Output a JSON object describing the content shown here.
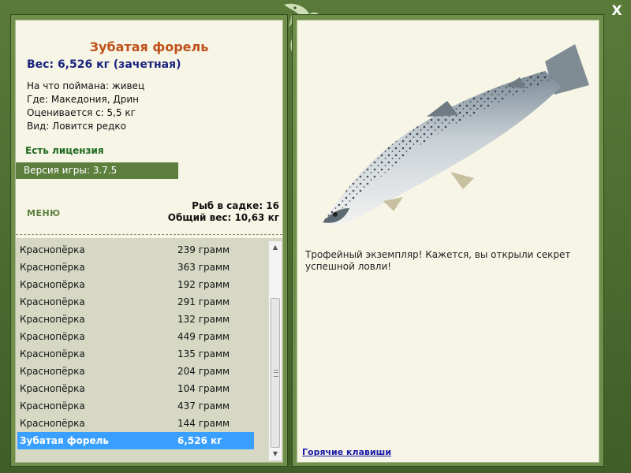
{
  "window": {
    "close_label": "X"
  },
  "fish": {
    "title": "Зубатая форель",
    "weight": "Вес: 6,526 кг (зачетная)",
    "bait": "На что поймана: живец",
    "place": "Где: Македония, Дрин",
    "rated_from": "Оценивается с: 5,5 кг",
    "kind": "Вид: Ловится редко"
  },
  "license": "Есть лицензия",
  "version": "Версия игры: 3.7.5",
  "menu_label": "МЕНЮ",
  "stats": {
    "count": "Рыб в садке: 16",
    "total": "Общий вес: 10,63 кг"
  },
  "catch_list": [
    {
      "name": "Краснопёрка",
      "weight": "239 грамм"
    },
    {
      "name": "Краснопёрка",
      "weight": "363 грамм"
    },
    {
      "name": "Краснопёрка",
      "weight": "192 грамм"
    },
    {
      "name": "Краснопёрка",
      "weight": "291 грамм"
    },
    {
      "name": "Краснопёрка",
      "weight": "132 грамм"
    },
    {
      "name": "Краснопёрка",
      "weight": "449 грамм"
    },
    {
      "name": "Краснопёрка",
      "weight": "135 грамм"
    },
    {
      "name": "Краснопёрка",
      "weight": "204 грамм"
    },
    {
      "name": "Краснопёрка",
      "weight": "104 грамм"
    },
    {
      "name": "Краснопёрка",
      "weight": "437 грамм"
    },
    {
      "name": "Краснопёрка",
      "weight": "144 грамм"
    },
    {
      "name": "Зубатая форель",
      "weight": "6,526 кг"
    }
  ],
  "message": "Трофейный экземпляр! Кажется, вы открыли секрет успешной ловли!",
  "hotkeys_label": "Горячие клавиши",
  "icons": {
    "logo": "fish-logo-icon",
    "close": "close-icon",
    "fish_image": "trout-image"
  }
}
